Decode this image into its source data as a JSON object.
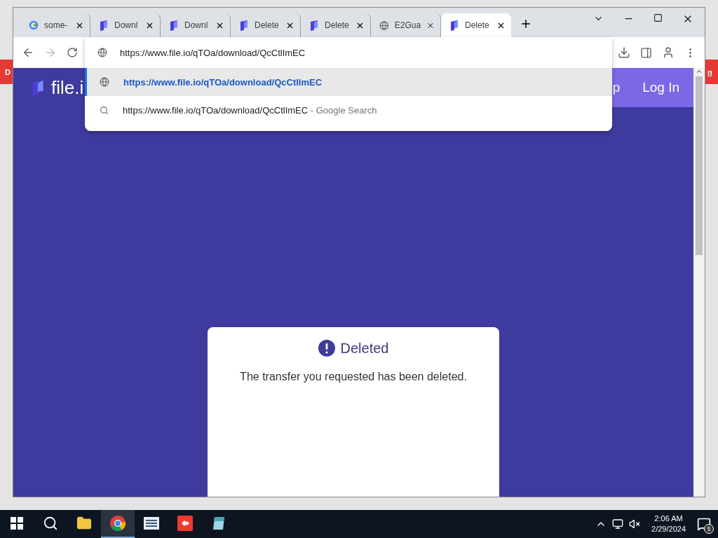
{
  "behind_window": {
    "left_text": "D",
    "right_text": "n"
  },
  "tabs": [
    {
      "kind": "google",
      "label": "some-",
      "selected": false
    },
    {
      "kind": "fileio",
      "label": "Downl",
      "selected": false
    },
    {
      "kind": "fileio",
      "label": "Downl",
      "selected": false
    },
    {
      "kind": "fileio",
      "label": "Delete",
      "selected": false
    },
    {
      "kind": "fileio",
      "label": "Delete",
      "selected": false
    },
    {
      "kind": "globe",
      "label": "E2Gua",
      "selected": false
    },
    {
      "kind": "fileio",
      "label": "Delete",
      "selected": true
    }
  ],
  "omnibox": {
    "value": "https://www.file.io/qTOa/download/QcCtlImEC"
  },
  "suggestions": [
    {
      "kind": "url",
      "text": "https://www.file.io/qTOa/download/QcCtlImEC",
      "selected": true
    },
    {
      "kind": "search",
      "text": "https://www.file.io/qTOa/download/QcCtlImEC",
      "suffix": " - Google Search",
      "selected": false
    }
  ],
  "page": {
    "logo": "file.i",
    "nav_partial": "p",
    "login": "Log In",
    "card": {
      "title": "Deleted",
      "message": "The transfer you requested has been deleted."
    }
  },
  "taskbar": {
    "time": "2:06 AM",
    "date": "2/29/2024",
    "notifications": "5"
  }
}
